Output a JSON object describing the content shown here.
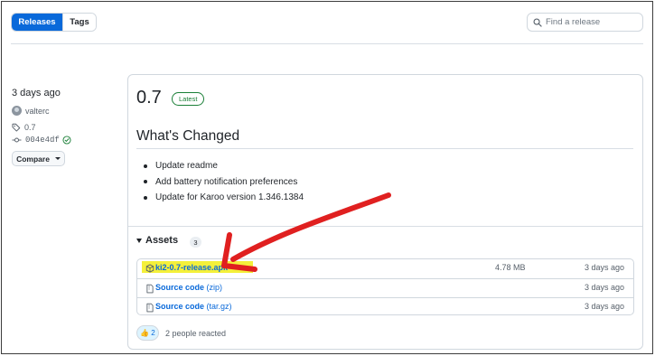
{
  "tabs": [
    {
      "label": "Releases",
      "active": true
    },
    {
      "label": "Tags",
      "active": false
    }
  ],
  "search": {
    "placeholder": "Find a release",
    "value": ""
  },
  "meta": {
    "date": "3 days ago",
    "author": "valterc",
    "tag": "0.7",
    "commit": "004e4df",
    "compare_label": "Compare"
  },
  "release": {
    "version": "0.7",
    "badge": "Latest",
    "heading": "What's Changed",
    "changes": [
      "Update readme",
      "Add battery notification preferences",
      "Update for Karoo version 1.346.1384"
    ],
    "assets_label": "Assets",
    "assets_count": "3",
    "assets": [
      {
        "name": "ki2-0.7-release.apk",
        "ext": "",
        "size": "4.78 MB",
        "date": "3 days ago",
        "icon": "package-icon"
      },
      {
        "name": "Source code",
        "ext": "(zip)",
        "size": "",
        "date": "3 days ago",
        "icon": "file-zip-icon"
      },
      {
        "name": "Source code",
        "ext": "(tar.gz)",
        "size": "",
        "date": "3 days ago",
        "icon": "file-zip-icon"
      }
    ],
    "reaction_count": "2",
    "reaction_text": "2 people reacted"
  },
  "colors": {
    "accent": "#0969da",
    "success": "#1a7f37",
    "highlight": "#f4f03a",
    "annotation_arrow": "#e02020"
  }
}
